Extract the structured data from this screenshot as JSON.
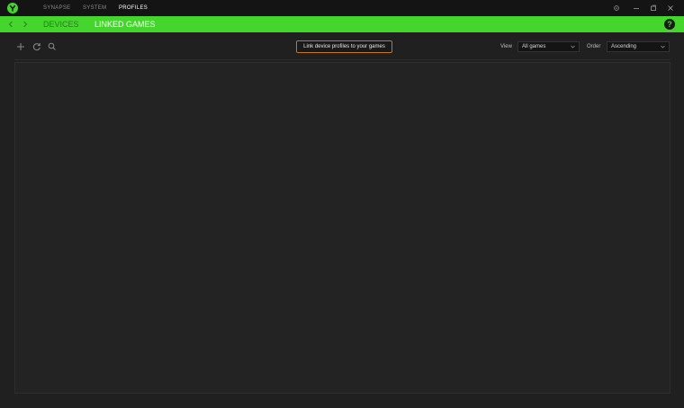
{
  "titlebar": {
    "tabs": [
      {
        "label": "SYNAPSE",
        "active": false
      },
      {
        "label": "SYSTEM",
        "active": false
      },
      {
        "label": "PROFILES",
        "active": true
      }
    ]
  },
  "navbar": {
    "tabs": [
      {
        "label": "DEVICES",
        "active": false
      },
      {
        "label": "LINKED GAMES",
        "active": true
      }
    ],
    "help_label": "?"
  },
  "toolbar": {
    "tooltip": "Link device profiles to your games",
    "view_label": "View",
    "view_value": "All games",
    "order_label": "Order",
    "order_value": "Ascending"
  },
  "colors": {
    "accent": "#44d62c",
    "background": "#202020",
    "tooltip_border": "#c8731e"
  }
}
